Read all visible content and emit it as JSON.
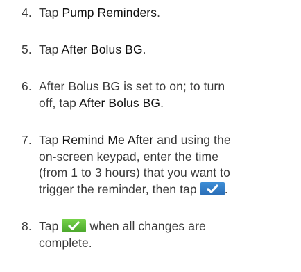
{
  "steps": [
    {
      "number": "4.",
      "text_before": "Tap ",
      "term": "Pump Reminders",
      "text_after": "."
    },
    {
      "number": "5.",
      "text_before": "Tap ",
      "term": "After Bolus BG",
      "text_after": "."
    },
    {
      "number": "6.",
      "line1": "After Bolus BG is set to on; to turn",
      "line2_before": "off, tap ",
      "line2_term": "After Bolus BG",
      "line2_after": "."
    },
    {
      "number": "7.",
      "text_before": "Tap ",
      "term": "Remind Me After",
      "text_after": " and using the",
      "line2": "on-screen keypad, enter the time",
      "line3": "(from 1 to 3 hours) that you want to",
      "line4_before": "trigger the reminder, then tap ",
      "line4_after": ".",
      "button_icon": "checkmark-icon",
      "button_color": "#3a7fc8"
    },
    {
      "number": "8.",
      "text_before": "Tap ",
      "text_after": " when all changes are",
      "line2": "complete.",
      "button_icon": "checkmark-icon",
      "button_color": "#5dbd38"
    }
  ]
}
